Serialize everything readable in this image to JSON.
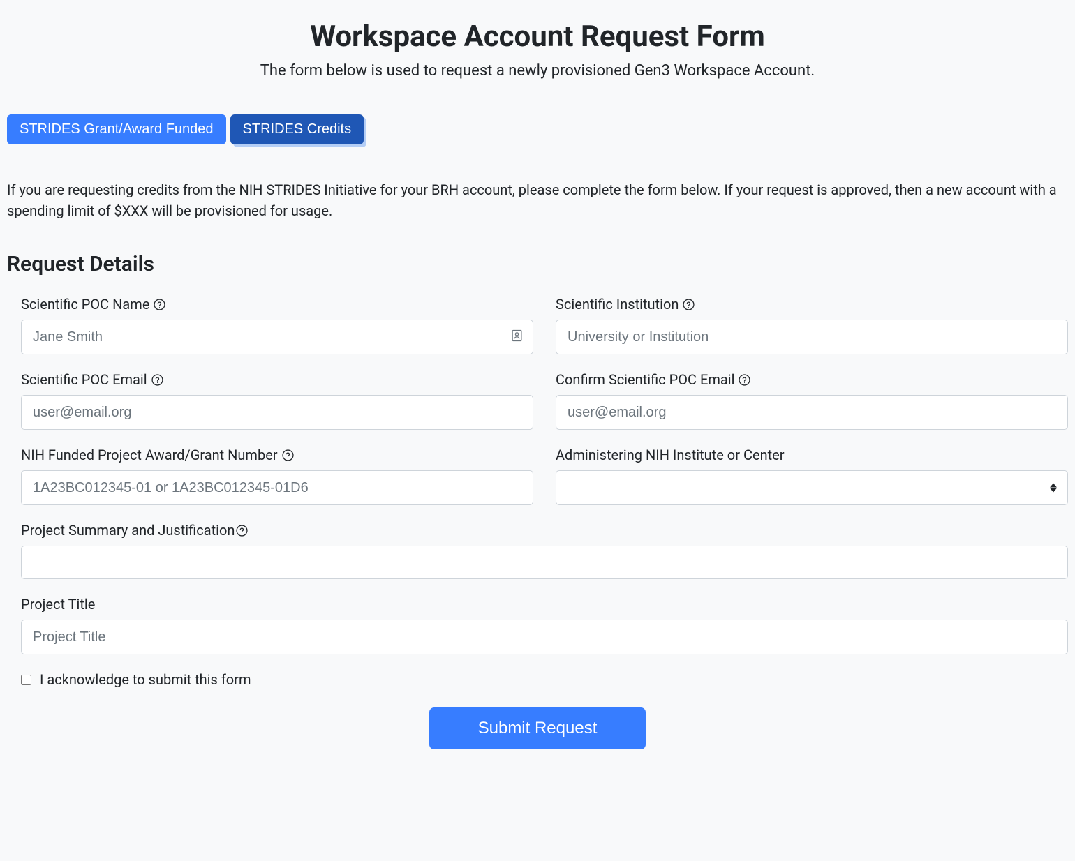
{
  "header": {
    "title": "Workspace Account Request Form",
    "subtitle": "The form below is used to request a newly provisioned Gen3 Workspace Account."
  },
  "tabs": {
    "inactive_label": "STRIDES Grant/Award Funded",
    "active_label": "STRIDES Credits"
  },
  "intro": "If you are requesting credits from the NIH STRIDES Initiative for your BRH account, please complete the form below. If your request is approved, then a new account with a spending limit of $XXX will be provisioned for usage.",
  "section_heading": "Request Details",
  "fields": {
    "poc_name": {
      "label": "Scientific POC Name",
      "placeholder": "Jane Smith",
      "value": ""
    },
    "institution": {
      "label": "Scientific Institution",
      "placeholder": "University or Institution",
      "value": ""
    },
    "poc_email": {
      "label": "Scientific POC Email",
      "placeholder": "user@email.org",
      "value": ""
    },
    "confirm_poc_email": {
      "label": "Confirm Scientific POC Email",
      "placeholder": "user@email.org",
      "value": ""
    },
    "grant_number": {
      "label": "NIH Funded Project Award/Grant Number",
      "placeholder": "1A23BC012345-01 or 1A23BC012345-01D6",
      "value": ""
    },
    "nih_institute": {
      "label": "Administering NIH Institute or Center",
      "value": ""
    },
    "project_summary": {
      "label": "Project Summary and Justification",
      "value": ""
    },
    "project_title": {
      "label": "Project Title",
      "placeholder": "Project Title",
      "value": ""
    }
  },
  "acknowledge": {
    "label": "I acknowledge to submit this form",
    "checked": false
  },
  "submit_label": "Submit Request"
}
